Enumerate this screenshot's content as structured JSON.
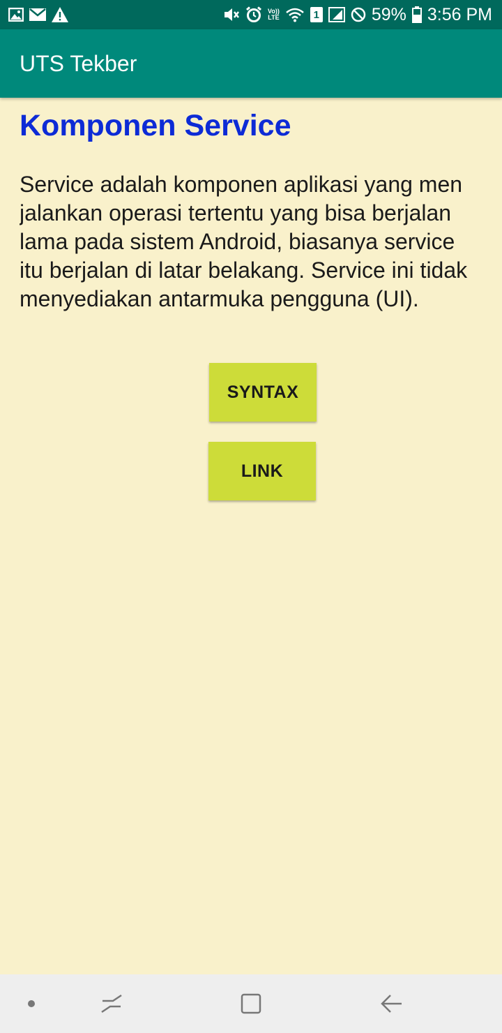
{
  "status_bar": {
    "battery_percent": "59%",
    "time": "3:56 PM",
    "volte_label_top": "Vo))",
    "volte_label_bottom": "LTE",
    "sim_number": "1",
    "icons_left": [
      "image-icon",
      "mail-icon",
      "warning-icon"
    ],
    "icons_right": [
      "mute-icon",
      "alarm-icon",
      "volte-icon",
      "wifi-icon",
      "sim-icon",
      "signal-icon",
      "do-not-disturb-icon",
      "battery-icon"
    ]
  },
  "app_bar": {
    "title": "UTS Tekber",
    "color": "#00897b"
  },
  "content": {
    "title": "Komponen Service",
    "paragraph_lines": [
      "Service adalah komponen aplikasi yang men",
      "jalankan operasi tertentu yang bisa berjalan",
      "lama pada sistem Android, biasanya service",
      "itu berjalan di latar belakang. Service ini tidak",
      "menyediakan antarmuka pengguna (UI)."
    ],
    "title_color": "#0d2bd6",
    "background_color": "#f9f1cb"
  },
  "buttons": {
    "syntax_label": "SYNTAX",
    "link_label": "LINK",
    "color": "#cddc39"
  },
  "nav_bar": {
    "icons": [
      "dot-icon",
      "recent-apps-icon",
      "home-icon",
      "back-icon"
    ]
  }
}
